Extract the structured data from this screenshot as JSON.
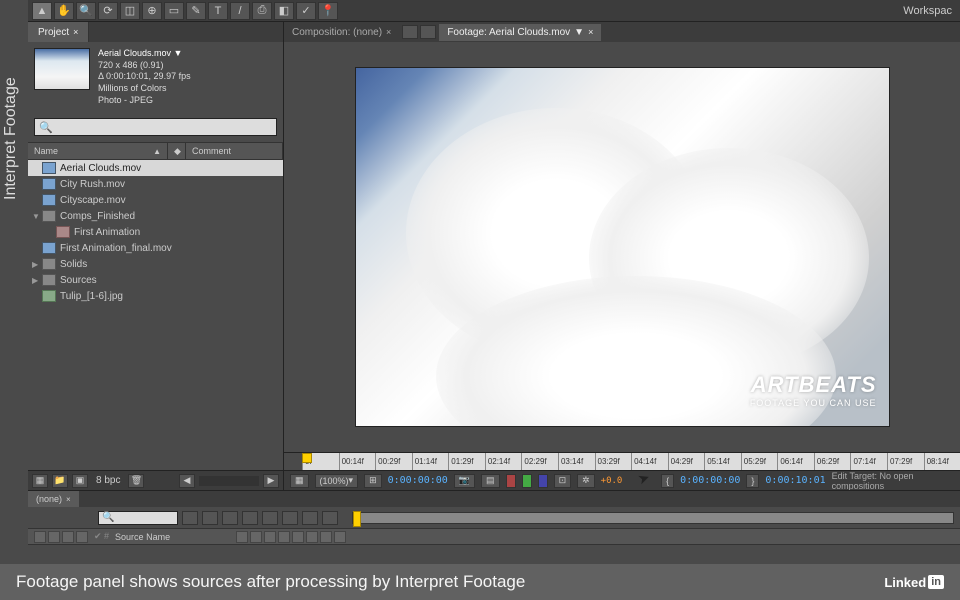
{
  "sidebar_title": "Interpret Footage",
  "workspace_label": "Workspac",
  "project_tab": "Project",
  "footage_info": {
    "name": "Aerial Clouds.mov ▼",
    "dims": "720 x 486 (0.91)",
    "duration": "Δ 0:00:10:01, 29.97 fps",
    "colors": "Millions of Colors",
    "codec": "Photo - JPEG"
  },
  "columns": {
    "name": "Name",
    "comment": "Comment"
  },
  "items": [
    {
      "label": "Aerial Clouds.mov",
      "type": "file",
      "selected": true
    },
    {
      "label": "City Rush.mov",
      "type": "file"
    },
    {
      "label": "Cityscape.mov",
      "type": "file"
    },
    {
      "label": "Comps_Finished",
      "type": "folder",
      "expanded": true
    },
    {
      "label": "First Animation",
      "type": "comp",
      "indent": true
    },
    {
      "label": "First Animation_final.mov",
      "type": "file"
    },
    {
      "label": "Solids",
      "type": "folder"
    },
    {
      "label": "Sources",
      "type": "folder"
    },
    {
      "label": "Tulip_[1-6].jpg",
      "type": "img"
    }
  ],
  "bpc": "8 bpc",
  "viewer_tabs": {
    "comp": "Composition: (none)",
    "footage": "Footage: Aerial Clouds.mov"
  },
  "watermark": {
    "brand": "ARTBEATS",
    "tag": "FOOTAGE YOU CAN USE"
  },
  "ruler": [
    "0f",
    "00:14f",
    "00:29f",
    "01:14f",
    "01:29f",
    "02:14f",
    "02:29f",
    "03:14f",
    "03:29f",
    "04:14f",
    "04:29f",
    "05:14f",
    "05:29f",
    "06:14f",
    "06:29f",
    "07:14f",
    "07:29f",
    "08:14f"
  ],
  "viewer_controls": {
    "zoom": "(100%)",
    "tc1": "0:00:00:00",
    "exposure": "+0.0",
    "tc2": "0:00:00:00",
    "tc3": "0:00:10:01",
    "edit_target": "Edit Target: No open compositions"
  },
  "timeline": {
    "tab": "(none)",
    "source_name": "Source Name"
  },
  "caption": "Footage panel shows sources after processing by Interpret Footage",
  "linkedin": "Linked"
}
